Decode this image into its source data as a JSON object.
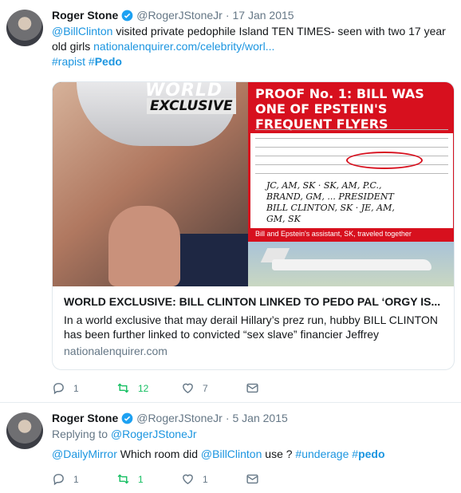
{
  "tweets": [
    {
      "name": "Roger Stone",
      "handle": "@RogerJStoneJr",
      "separator": "·",
      "date": "17 Jan 2015",
      "text_mention": "@BillClinton",
      "text_body": " visited private pedophile Island TEN TIMES- seen with two 17 year old girls ",
      "text_link": "nationalenquirer.com/celebrity/worl...",
      "hashtag1": "#rapist",
      "hashtag2_prefix": "#",
      "hashtag2_bold": "Pedo",
      "card": {
        "image_world": "WORLD",
        "image_exclusive": "EXCLUSIVE",
        "proof_title": "PROOF No. 1: BILL WAS ONE OF EPSTEIN'S FREQUENT FLYERS",
        "proof_note": "JC, AM, SK  ·  SK, AM, P.C., BRAND, GM, ...  PRESIDENT BILL CLINTON, SK  ·  JE, AM, GM, SK",
        "proof_caption": "Bill and Epstein's assistant, SK, traveled together",
        "title": "WORLD EXCLUSIVE: BILL CLINTON LINKED TO PEDO PAL ‘ORGY IS...",
        "description": "In a world exclusive that may derail Hillary’s prez run, hubby BILL CLINTON has been further linked to convicted “sex slave” financier Jeffrey",
        "domain": "nationalenquirer.com"
      },
      "actions": {
        "replies": "1",
        "retweets": "12",
        "likes": "7"
      }
    },
    {
      "name": "Roger Stone",
      "handle": "@RogerJStoneJr",
      "separator": "·",
      "date": "5 Jan 2015",
      "replying_prefix": "Replying to ",
      "replying_to": "@RogerJStoneJr",
      "text_mention1": "@DailyMirror",
      "text_body1": " Which room did ",
      "text_mention2": "@BillClinton",
      "text_body2": " use ? ",
      "hashtag1": "#underage",
      "hashtag2_prefix": "#",
      "hashtag2_bold": "pedo",
      "actions": {
        "replies": "1",
        "retweets": "1",
        "likes": "1"
      }
    }
  ],
  "colors": {
    "link": "#1b95e0",
    "retweet": "#17bf63",
    "muted": "#657786",
    "verified": "#1da1f2",
    "proof_red": "#d7101e"
  },
  "icons": {
    "verified": "verified-badge-icon",
    "reply": "reply-icon",
    "retweet": "retweet-icon",
    "like": "heart-icon",
    "dm": "envelope-icon"
  }
}
